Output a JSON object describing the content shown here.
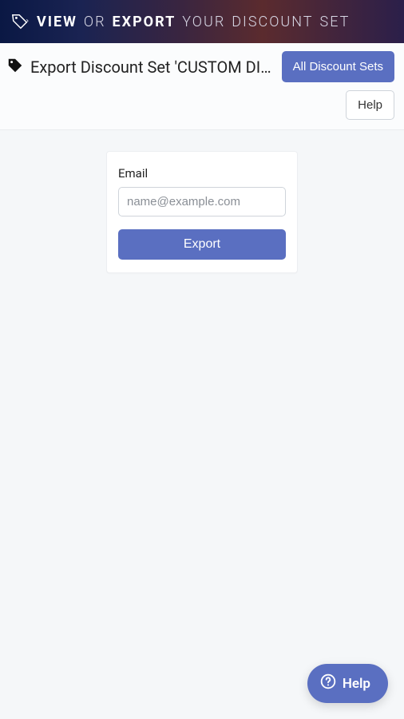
{
  "banner": {
    "w1": "VIEW",
    "w2": "OR",
    "w3": "EXPORT",
    "w4": "YOUR",
    "w5": "DISCOUNT",
    "w6": "SET"
  },
  "header": {
    "title": "Export Discount Set 'CUSTOM DISCOUNT'",
    "all_sets_label": "All Discount Sets",
    "help_label": "Help"
  },
  "form": {
    "email_label": "Email",
    "email_placeholder": "name@example.com",
    "export_label": "Export"
  },
  "widget": {
    "help_label": "Help"
  }
}
